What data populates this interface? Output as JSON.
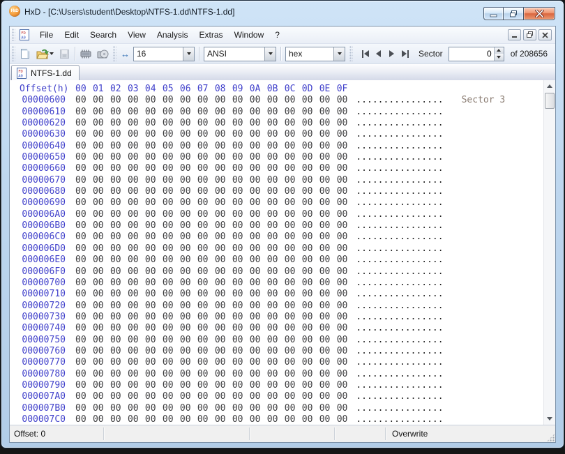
{
  "window": {
    "title": "HxD - [C:\\Users\\student\\Desktop\\NTFS-1.dd\\NTFS-1.dd]"
  },
  "menu_bar": {
    "items": [
      "File",
      "Edit",
      "Search",
      "View",
      "Analysis",
      "Extras",
      "Window",
      "?"
    ]
  },
  "toolbar": {
    "bytes_per_row": "16",
    "charset": "ANSI",
    "offset_base": "hex",
    "sector_label": "Sector",
    "sector_value": "0",
    "sector_total_label": "of 208656"
  },
  "tab_bar": {
    "active_tab": "NTFS-1.dd"
  },
  "hex_view": {
    "header_offset": "Offset(h)",
    "header_bytes": "00 01 02 03 04 05 06 07 08 09 0A 0B 0C 0D 0E 0F",
    "row_bytes": "00 00 00 00 00 00 00 00 00 00 00 00 00 00 00 00",
    "row_ascii": "................",
    "annotation": {
      "row_index": 0,
      "text": "Sector 3"
    },
    "row_offsets": [
      "00000600",
      "00000610",
      "00000620",
      "00000630",
      "00000640",
      "00000650",
      "00000660",
      "00000670",
      "00000680",
      "00000690",
      "000006A0",
      "000006B0",
      "000006C0",
      "000006D0",
      "000006E0",
      "000006F0",
      "00000700",
      "00000710",
      "00000720",
      "00000730",
      "00000740",
      "00000750",
      "00000760",
      "00000770",
      "00000780",
      "00000790",
      "000007A0",
      "000007B0",
      "000007C0"
    ]
  },
  "status_bar": {
    "offset_info": "Offset: 0",
    "mode": "Overwrite"
  },
  "colors": {
    "titlebar_blue": "#bed7ef",
    "offset_text": "#4141cb",
    "annotation_text": "#8b7d73",
    "close_button_red": "#d9653e"
  }
}
